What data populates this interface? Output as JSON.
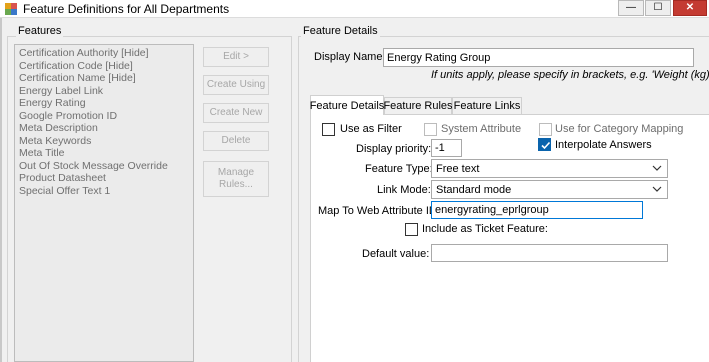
{
  "window": {
    "title": "Feature Definitions for All Departments",
    "minimize_glyph": "—",
    "maximize_glyph": "☐",
    "close_glyph": "✕"
  },
  "features_panel": {
    "label": "Features",
    "items": [
      "Certification Authority [Hide]",
      "Certification Code [Hide]",
      "Certification Name [Hide]",
      "Energy Label Link",
      "Energy Rating",
      "Google Promotion ID",
      "Meta Description",
      "Meta Keywords",
      "Meta Title",
      "Out Of Stock Message Override",
      "Product Datasheet",
      "Special Offer Text 1"
    ]
  },
  "buttons": {
    "edit": "Edit >",
    "create_using": "Create Using",
    "create_new": "Create New",
    "delete": "Delete",
    "manage_rules_line1": "Manage",
    "manage_rules_line2": "Rules..."
  },
  "feature_details": {
    "label": "Feature Details",
    "display_name_label": "Display Name:",
    "display_name_value": "Energy Rating Group",
    "units_hint": "If units apply, please specify in brackets, e.g. 'Weight (kg)'"
  },
  "tabs": {
    "details": "Feature Details",
    "rules": "Feature Rules",
    "links": "Feature Links"
  },
  "details_tab": {
    "use_as_filter": "Use as Filter",
    "system_attribute": "System Attribute",
    "use_for_category_mapping": "Use for Category Mapping",
    "display_priority_label": "Display priority:",
    "display_priority_value": "-1",
    "interpolate_answers": "Interpolate Answers",
    "feature_type_label": "Feature Type:",
    "feature_type_value": "Free text",
    "link_mode_label": "Link Mode:",
    "link_mode_value": "Standard mode",
    "map_web_attribute_label": "Map To Web Attribute ID:",
    "map_web_attribute_value": "energyrating_eprlgroup",
    "include_ticket_feature": "Include as Ticket Feature:",
    "default_value_label": "Default value:",
    "default_value_value": ""
  },
  "colors": {
    "accent": "#0078d7",
    "checkbox_checked": "#0a64ad",
    "close_button": "#c43b32"
  }
}
